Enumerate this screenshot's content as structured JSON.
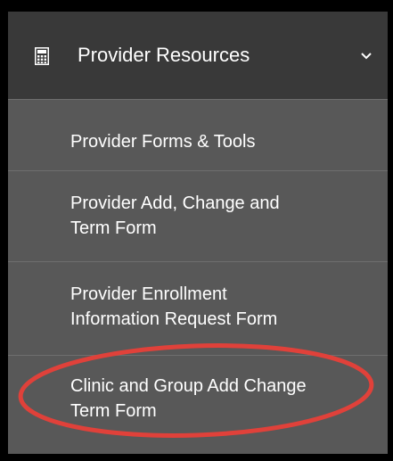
{
  "menu": {
    "header": {
      "title": "Provider Resources",
      "icon": "calculator-icon",
      "expand_icon": "chevron-down-icon"
    },
    "items": [
      {
        "lines": [
          "Provider Forms & Tools"
        ]
      },
      {
        "lines": [
          "Provider Add, Change and",
          "Term Form"
        ]
      },
      {
        "lines": [
          "Provider Enrollment",
          "Information Request Form"
        ]
      },
      {
        "lines": [
          "Clinic and Group Add Change",
          "Term Form"
        ]
      }
    ]
  },
  "colors": {
    "header_bg": "#393939",
    "item_bg": "#585858",
    "text": "#ffffff",
    "highlight_ring": "#e0413a"
  }
}
